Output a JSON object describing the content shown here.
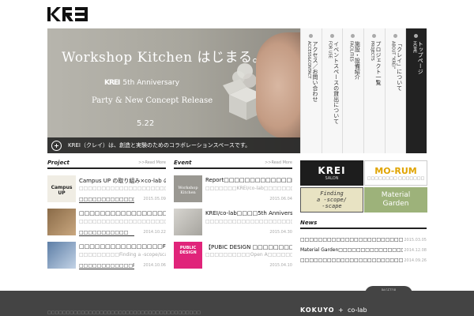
{
  "logo": {
    "text": "KREI"
  },
  "hero": {
    "title": "Workshop Kitchen はじまる。",
    "anniv_brand": "KREI",
    "anniv": "5th Anniversary",
    "party": "Party & New Concept Release",
    "date": "5.22",
    "caption": "KREI（クレイ）は、創造と実験のためのコラボレーションスペースです。"
  },
  "nav": [
    {
      "ja": "アクセス／お問い合わせ",
      "en": "ACCESS&CONTACT"
    },
    {
      "ja": "イベントスペースの貸出について",
      "en": "FOR USE"
    },
    {
      "ja": "施設・設備紹介",
      "en": "FACILITIES"
    },
    {
      "ja": "プロジェクト一覧",
      "en": "PROJECTS"
    },
    {
      "ja": "「クレイ」について",
      "en": "ABOUT \"KREI\""
    },
    {
      "ja": "トップページ",
      "en": "HOME"
    }
  ],
  "project": {
    "heading": "Project",
    "more": ">>Read More",
    "items": [
      {
        "title": "Campus UP の取り組み×co-lab の取り組み",
        "desc": "□□□□□□□□□□□□□□□□□□□□□co-lab□□□□□□□□",
        "link": "□□□□□□□□□□□□□□",
        "date": "2015.05.09",
        "thumb": "Campus UP"
      },
      {
        "title": "□□□□□□□□□□□□□□□□□□□□□□□□□□□□□□□□",
        "desc": "□□□□□□□□□□□□□□□□□□□□□□□□□□□□□□□□□",
        "link": "□□□□□□□□□□□",
        "date": "2014.10.22",
        "thumb": ""
      },
      {
        "title": "□□□□□□□□□□□□□□□□Finding a -scope/-",
        "desc": "□□□□□□□□□Finding a -scope/scape +",
        "link": "□□□□□□□□□□□□Finding a",
        "date": "2014.10.06",
        "thumb": ""
      }
    ]
  },
  "event": {
    "heading": "Event",
    "more": ">>Read More",
    "items": [
      {
        "title": "Report□□□□□□□□□□□□□□□□□□□□□□□ –",
        "desc": "□□□□□□□KREI/co-lab□□□□□□□□□□□□□□",
        "date": "2015.06.04",
        "thumb": "Workshop Kitchen"
      },
      {
        "title": "KREI/co-lab□□□□5th Anniversary",
        "desc": "□□□□□□□□□□□□□□□□□□□□□□□□□□□□□□□□",
        "date": "2015.04.30",
        "thumb": ""
      },
      {
        "title": "【PUBIC DESIGN □□□□□□□□□□□□□□□□□□",
        "desc": "□□□□□□□□□□Open A□□□□□□□□□□□□□□□",
        "date": "2015.04.10",
        "thumb": "PUBLIC DESIGN"
      }
    ]
  },
  "banners": {
    "salon": {
      "big": "KREI",
      "small": "SALON"
    },
    "morum": {
      "big": "MO-RUM",
      "small": "□□□□□□□□ □□□□□□□"
    },
    "finding": {
      "line1": "Finding",
      "line2": "a -scope/",
      "line3": "-scape"
    },
    "material": {
      "line1": "Material",
      "line2": "Garden"
    }
  },
  "news": {
    "heading": "News",
    "items": [
      {
        "title": "□□□□□□□□□□□□□□□□□□□□□□□□□□□□□□□□",
        "date": "2015.03.05"
      },
      {
        "title": "Material Garden□□□□□□□□□□□□□□□□□□□□□",
        "date": "2014.12.08"
      },
      {
        "title": "□□□□□□□□□□□□□□□□□□□□□□□□□□□□",
        "date": "2014.09.26"
      }
    ]
  },
  "footer": {
    "pagetop": "PAGETOP",
    "copy": "□□□□□□□□□□□□□□□□□□□□□□□□□□□□□□□□□□□□□□□□□",
    "kokuyo": "KOKUYO",
    "plus": "+",
    "colab": "co-lab"
  }
}
